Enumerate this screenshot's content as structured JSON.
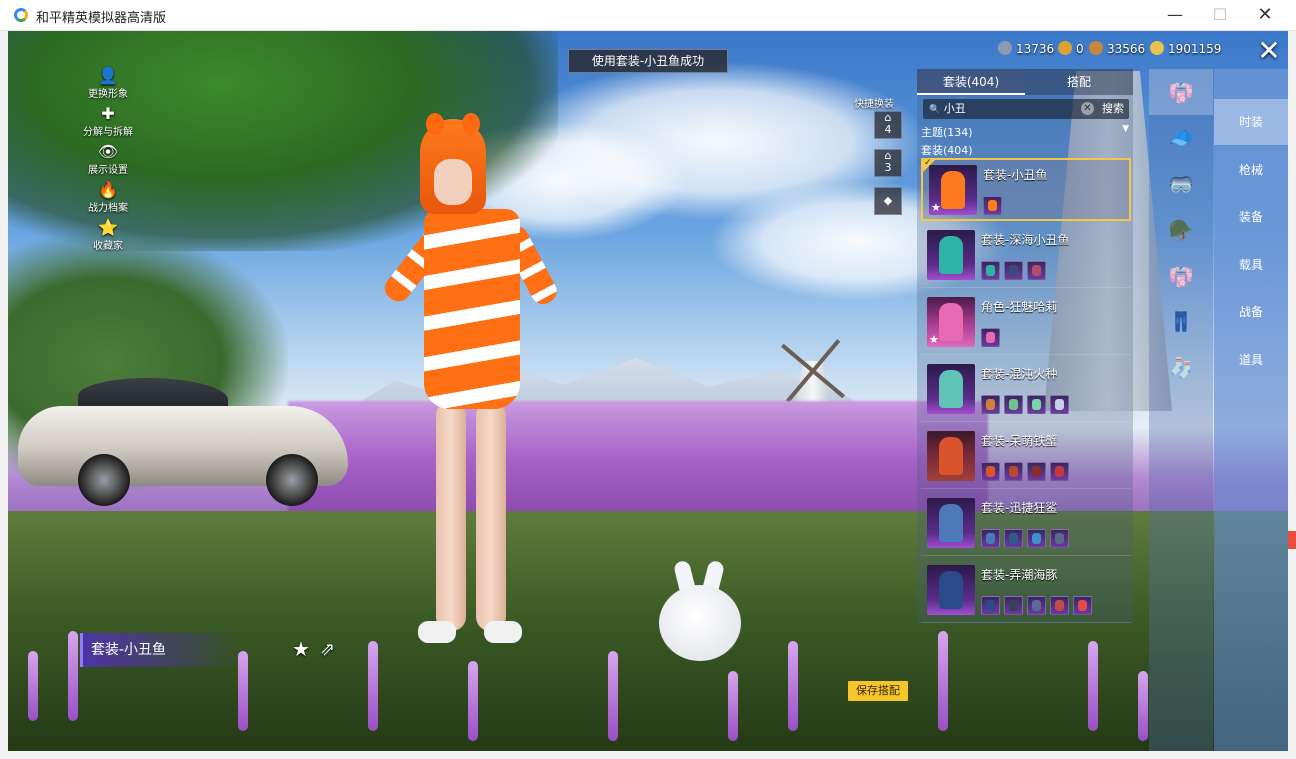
{
  "window": {
    "title": "和平精英模拟器高清版",
    "min": "—",
    "max": "☐",
    "close": "✕"
  },
  "hud": {
    "menu": [
      {
        "label": "更换形象",
        "glyph": "👤"
      },
      {
        "label": "分解与拆解",
        "glyph": "✚"
      },
      {
        "label": "展示设置",
        "glyph": "👁"
      },
      {
        "label": "战力档案",
        "glyph": "🔥"
      },
      {
        "label": "收藏家",
        "glyph": "⭐"
      }
    ],
    "toast": "使用套装-小丑鱼成功",
    "currencies": [
      {
        "value": "13736",
        "color": "#8c9bb0"
      },
      {
        "value": "0",
        "color": "#d9a336"
      },
      {
        "value": "33566",
        "color": "#c9873a"
      },
      {
        "value": "1901159",
        "color": "#e6c34b"
      }
    ],
    "close": "✕",
    "quick_label": "快捷换装",
    "quick_slots": [
      "4",
      "3",
      "◆"
    ]
  },
  "panel": {
    "tabs": [
      "套装(404)",
      "搭配"
    ],
    "search": {
      "value": "小丑",
      "clear": "✕",
      "button": "搜索",
      "icon": "🔍"
    },
    "filter": {
      "label": "主题(134)",
      "caret": "▼"
    },
    "sub_count": "套装(404)",
    "items": [
      {
        "name": "套装-小丑鱼",
        "selected": true,
        "figure": "#ff7a1c",
        "minis": [
          "#ff7a1c"
        ]
      },
      {
        "name": "套装-深海小丑鱼",
        "selected": false,
        "figure": "#2fb3a6",
        "minis": [
          "#2fb3a6",
          "#3d4a7a",
          "#b0506a"
        ]
      },
      {
        "name": "角色-狂魅哈莉",
        "selected": false,
        "figure": "#e76ab3",
        "minis": [
          "#e76ab3"
        ]
      },
      {
        "name": "套装-混沌火种",
        "selected": false,
        "figure": "#5fc4b7",
        "minis": [
          "#d0803a",
          "#6fc38a",
          "#79d4a6",
          "#c7d0e6"
        ]
      },
      {
        "name": "套装-呆萌铁蟹",
        "selected": false,
        "figure": "#d9532c",
        "minis": [
          "#d9532c",
          "#b94a2c",
          "#8a2c2c",
          "#c43a3a"
        ]
      },
      {
        "name": "套装-迅捷狂鲨",
        "selected": false,
        "figure": "#4c7ab8",
        "minis": [
          "#4c7ab8",
          "#2f5a8a",
          "#3e8fd0",
          "#5a6a8a"
        ]
      },
      {
        "name": "套装-弄潮海豚",
        "selected": false,
        "figure": "#2a4a8a",
        "minis": [
          "#2a4a8a",
          "#3a3f5a",
          "#5a6a9a",
          "#c24a4a",
          "#e04a4a"
        ]
      }
    ]
  },
  "icon_column": [
    "👘",
    "🧢",
    "🥽",
    "🪖",
    "👘",
    "👖",
    "🧦"
  ],
  "categories": [
    {
      "label": "时装",
      "active": true
    },
    {
      "label": "枪械",
      "active": false
    },
    {
      "label": "装备",
      "active": false
    },
    {
      "label": "载具",
      "active": false
    },
    {
      "label": "战备",
      "active": false
    },
    {
      "label": "道具",
      "active": false
    }
  ],
  "bottom": {
    "outfit_label": "套装-小丑鱼",
    "fav_icon": "★",
    "share_icon": "⇗",
    "save_button": "保存搭配"
  }
}
